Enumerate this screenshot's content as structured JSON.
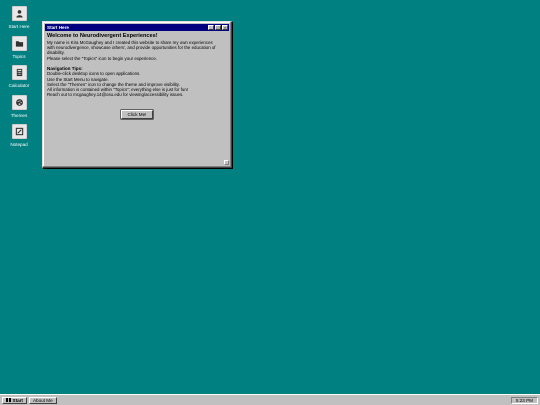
{
  "desktop": {
    "background_color": "#008080",
    "icons": [
      {
        "label": "Start Here",
        "icon": "person-icon"
      },
      {
        "label": "Topics",
        "icon": "folder-icon"
      },
      {
        "label": "Calculator",
        "icon": "calculator-icon"
      },
      {
        "label": "Themes",
        "icon": "palette-icon"
      },
      {
        "label": "Notepad",
        "icon": "notepad-icon"
      }
    ]
  },
  "window": {
    "title": "Start Here",
    "controls": {
      "minimize": "_",
      "maximize": "□",
      "close": "×"
    },
    "heading": "Welcome to Neurodivergent Experiences!",
    "intro": [
      "My name is Kira McGaughey and I created this website to share my own experiences",
      "with neurodivergence, showcase others', and provide opportunities for the education of",
      "disability.",
      "Please select the \"Topics\" icon to begin your experience."
    ],
    "tips_heading": "Navigation Tips:",
    "tips": [
      "Double-click desktop icons to open applications.",
      "Use the Start Menu to navigate.",
      "Select the \"Themes\" icon to change the theme and improve visibility.",
      "All information is contained within \"Topics\"; everything else is just for fun!",
      "Reach out to mcgaughey.14@osu.edu for viewing/accessibility issues."
    ],
    "button_label": "Click Me!"
  },
  "taskbar": {
    "start_label": "Start",
    "tasks": [
      "About Me"
    ],
    "clock": "5:23 PM"
  }
}
